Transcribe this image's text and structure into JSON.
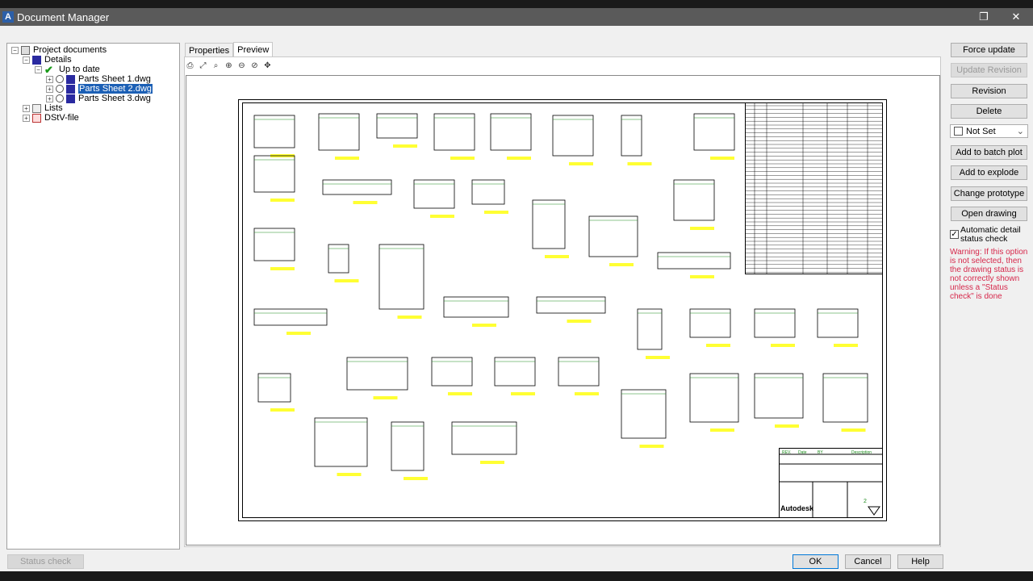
{
  "window": {
    "title": "Document Manager",
    "icon": "autocad-a-icon"
  },
  "tree": {
    "root": "Project documents",
    "details": "Details",
    "status_group": "Up to date",
    "files": [
      "Parts Sheet 1.dwg",
      "Parts Sheet 2.dwg",
      "Parts Sheet 3.dwg"
    ],
    "selected": "Parts Sheet 2.dwg",
    "lists": "Lists",
    "dstv": "DStV-file"
  },
  "tabs": [
    {
      "label": "Properties",
      "active": false
    },
    {
      "label": "Preview",
      "active": true
    }
  ],
  "toolbar_icons": [
    "print-icon",
    "zoom-extents-icon",
    "zoom-window-icon",
    "zoom-in-icon",
    "zoom-out-icon",
    "zoom-previous-icon",
    "pan-icon"
  ],
  "drawing": {
    "title_block": {
      "headers": [
        "REV.",
        "Date",
        "BY",
        "Description"
      ],
      "logo": "Autodesk",
      "sheet_number": "2"
    }
  },
  "actions": {
    "force_update": "Force update",
    "update_revision": "Update Revision",
    "revision": "Revision",
    "delete": "Delete",
    "status_select": "Not Set",
    "add_batch_plot": "Add to batch plot",
    "add_explode": "Add to explode",
    "change_prototype": "Change prototype",
    "open_drawing": "Open drawing",
    "auto_check_label": "Automatic detail status check",
    "auto_check_checked": true,
    "warning": "Warning: If this option is not selected, then the drawing status is not correctly shown unless a \"Status check\" is done"
  },
  "footer": {
    "status_check": "Status check",
    "ok": "OK",
    "cancel": "Cancel",
    "help": "Help"
  },
  "colors": {
    "warning": "#d6284b",
    "selection": "#1b5fb5",
    "dim_green": "#1a8a1a",
    "label_yellow": "#ffff33"
  }
}
